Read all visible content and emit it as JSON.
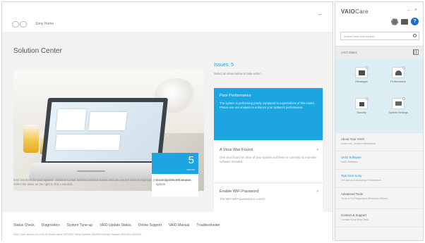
{
  "header": {
    "home_link": "Sony Home",
    "minimize": "–"
  },
  "main": {
    "page_title": "Solution Center",
    "hero_caption": "Intel Solutions for your system · Solution Center detects potential issues and can resolve them to maintain your computer's performance. Select the issue on the right to find a solution.",
    "info_box": {
      "number": "5",
      "unit": "issues",
      "description": "Currently detected on your system"
    },
    "issues": {
      "heading": "Issues: 5",
      "subtitle": "Select an issue below to take action.",
      "items": [
        {
          "title": "Poor Performance",
          "body": "The system is performing poorly compared to expectations of this model. Please use our analysis to enhance your system's performance.",
          "active": true
        },
        {
          "title": "A Virus Was Found",
          "body": "One virus found on drive of your system and there is currently no real-time software installed.",
          "active": false
        },
        {
          "title": "Enable WiFi Password",
          "body": "The WiFi WPA password is current",
          "active": false
        }
      ]
    }
  },
  "bottom": {
    "tools": [
      "Status Check",
      "Diagnostics",
      "System Tune-up",
      "VAIO Update Status",
      "Online Support",
      "VAIO Manual",
      "Troubleshooter"
    ],
    "copyright": "VAIO Care version 8.0.0.01.09 Model name SVF1531 Serial Number 3002400 Service Number 3002400-3002400"
  },
  "side": {
    "title_bold": "VAIO",
    "title_rest": "Care",
    "window_controls": [
      "–",
      "×"
    ],
    "search_placeholder": "Search help and support",
    "status_label": "VAIO Status",
    "tiles": [
      {
        "label": "Messages",
        "icon": "envelope-icon"
      },
      {
        "label": "Performance",
        "icon": "gauge-icon"
      },
      {
        "label": "Security",
        "icon": "lock-icon"
      },
      {
        "label": "System Settings",
        "icon": "display-icon"
      }
    ],
    "list": [
      {
        "title": "About Your VAIO",
        "desc": "Learn info, product information",
        "blue": false
      },
      {
        "title": "VAIO Software",
        "desc": "VAIO Software",
        "blue": true
      },
      {
        "title": "Tips from Sony",
        "desc": "Get tips on Enhancing Performance",
        "blue": true
      },
      {
        "title": "Advanced Tools",
        "desc": "Tools to Fix Diagnostics Recovery Wizard",
        "blue": false
      },
      {
        "title": "Contact & Support",
        "desc": "Contact Sony Help Desk",
        "blue": false
      }
    ]
  },
  "colors": {
    "accent": "#1ca5e0",
    "tile_bg": "#dcedf4",
    "help": "#1a6fc4"
  }
}
